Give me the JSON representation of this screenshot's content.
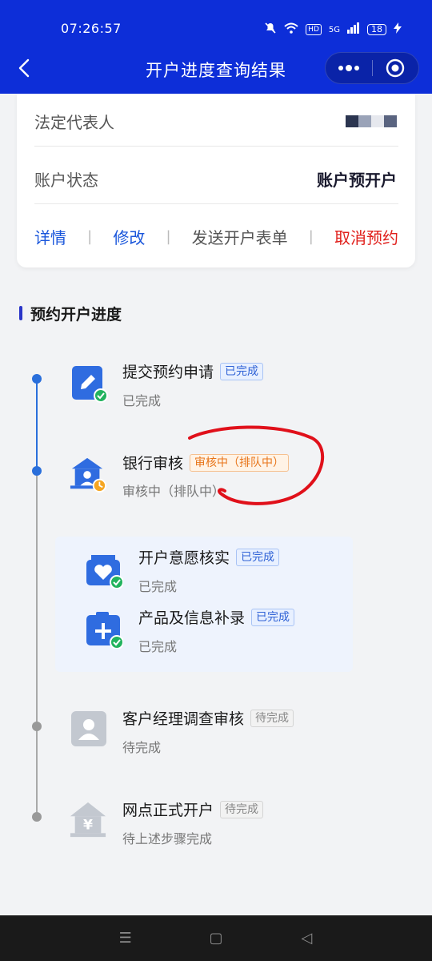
{
  "status_bar": {
    "time": "07:26:57",
    "network": "5G",
    "hd": "HD",
    "battery": "18"
  },
  "header": {
    "title": "开户进度查询结果"
  },
  "account_card": {
    "rows": [
      {
        "label": "法定代表人",
        "value": ""
      },
      {
        "label": "账户状态",
        "value": "账户预开户"
      }
    ],
    "actions": {
      "details": "详情",
      "modify": "修改",
      "send_form": "发送开户表单",
      "cancel": "取消预约"
    }
  },
  "section": {
    "title": "预约开户进度"
  },
  "steps": [
    {
      "title": "提交预约申请",
      "tag": "已完成",
      "sub": "已完成"
    },
    {
      "title": "银行审核",
      "tag": "审核中（排队中）",
      "sub": "审核中（排队中）"
    },
    {
      "title": "开户意愿核实",
      "tag": "已完成",
      "sub": "已完成"
    },
    {
      "title": "产品及信息补录",
      "tag": "已完成",
      "sub": "已完成"
    },
    {
      "title": "客户经理调查审核",
      "tag": "待完成",
      "sub": "待完成"
    },
    {
      "title": "网点正式开户",
      "tag": "待完成",
      "sub": "待上述步骤完成"
    }
  ],
  "colors": {
    "header_bg": "#0d2ed8",
    "link": "#1a56db",
    "danger": "#e0201c",
    "annotation": "#e0101a"
  }
}
